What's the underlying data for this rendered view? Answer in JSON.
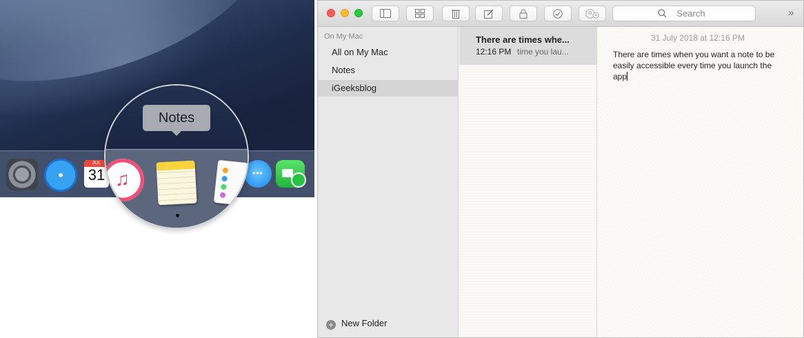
{
  "dock": {
    "tooltip": "Notes",
    "calendar_month": "JUL",
    "calendar_day": "31"
  },
  "window": {
    "toolbar": {
      "search_placeholder": "Search",
      "overflow": "»"
    },
    "sidebar": {
      "section_header": "On My Mac",
      "items": [
        {
          "label": "All on My Mac",
          "selected": false
        },
        {
          "label": "Notes",
          "selected": false
        },
        {
          "label": "iGeeksblog",
          "selected": true
        }
      ],
      "new_folder": "New Folder"
    },
    "note_list": [
      {
        "title": "There are times whe...",
        "time": "12:16 PM",
        "preview": "time you lau..."
      }
    ],
    "editor": {
      "date": "31 July 2018 at 12:16 PM",
      "body": "There are times when you want a note to be easily accessible every time you launch the app"
    }
  },
  "colors": {
    "close": "#fc5f57",
    "minimize": "#fdbc2e",
    "zoom": "#28c840",
    "selection": "#d5d5d5"
  }
}
